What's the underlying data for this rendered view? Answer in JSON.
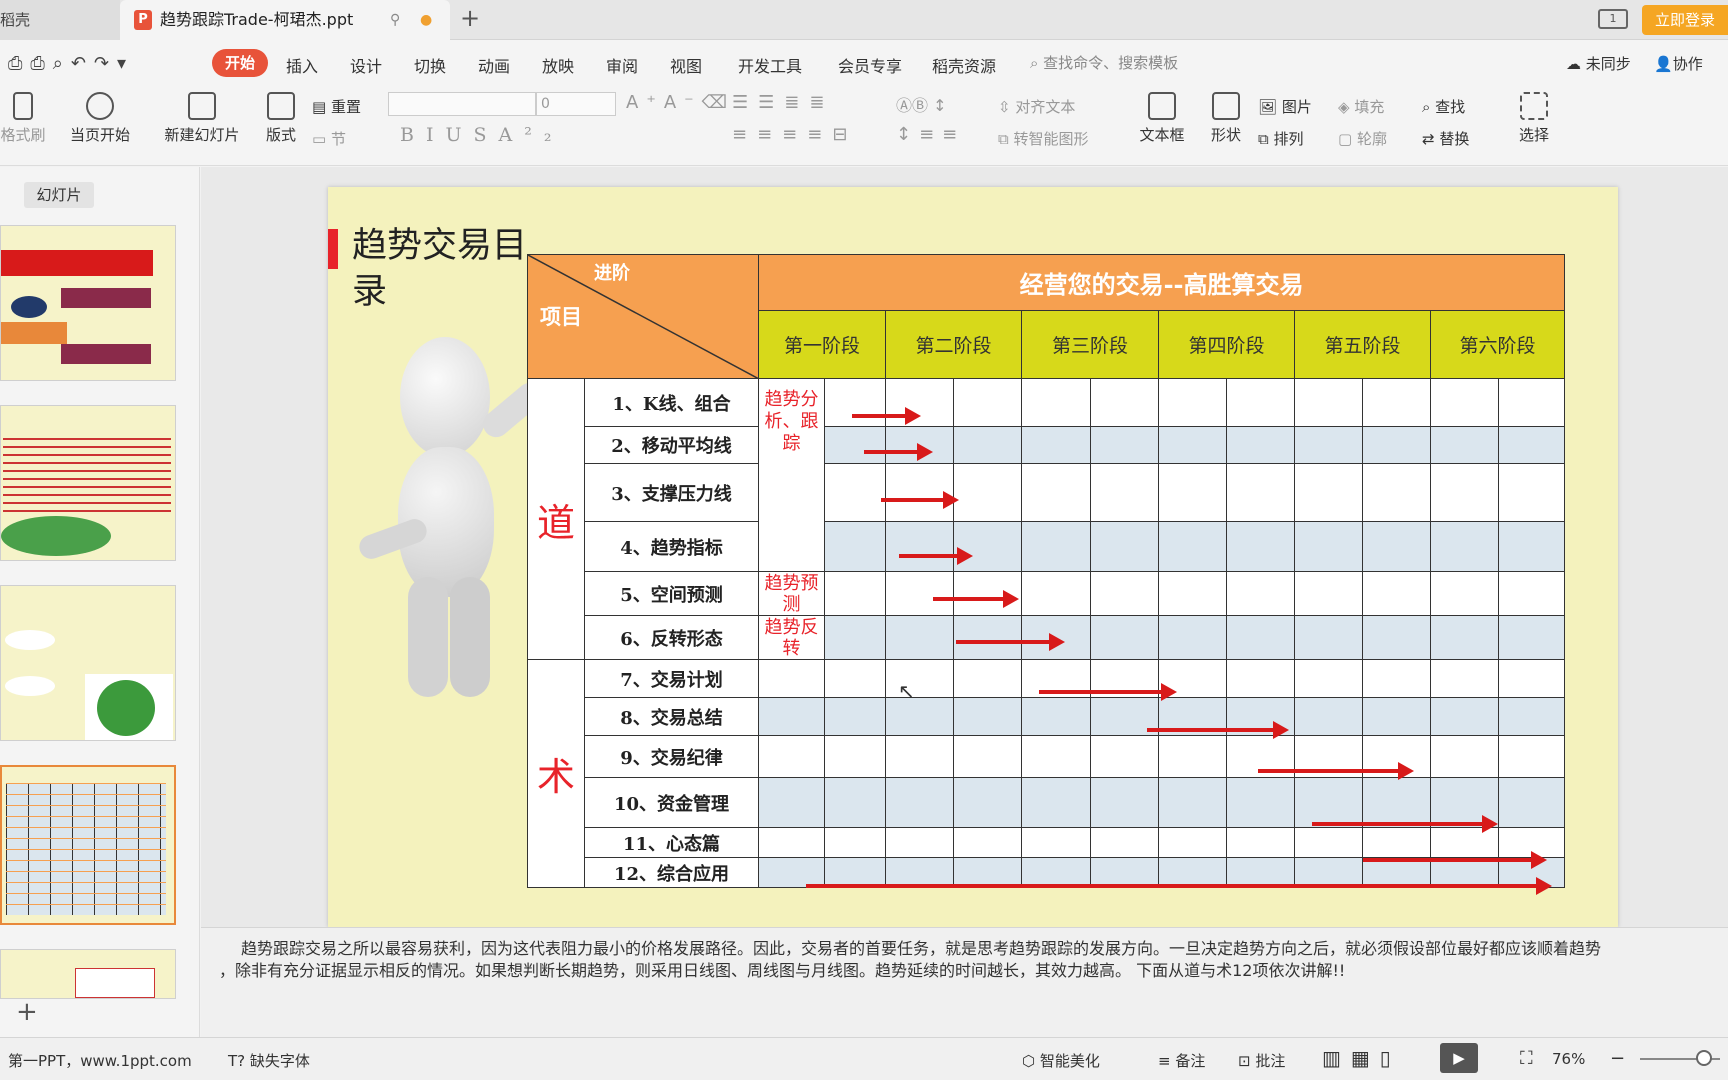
{
  "tabs": {
    "prev": "稻壳",
    "active": "趋势跟踪Trade-柯珺杰.ppt",
    "login": "立即登录"
  },
  "menu": {
    "items": [
      "开始",
      "插入",
      "设计",
      "切换",
      "动画",
      "放映",
      "审阅",
      "视图",
      "开发工具",
      "会员专享",
      "稻壳资源"
    ],
    "search": "查找命令、搜索模板",
    "sync": "未同步",
    "collab": "协作"
  },
  "ribbon": {
    "format_painter": "格式刷",
    "play_current": "当页开始",
    "new_slide": "新建幻灯片",
    "layout": "版式",
    "reset": "重置",
    "section": "节",
    "font_size": "0",
    "text_align": "对齐文本",
    "smart_shape": "转智能图形",
    "textbox": "文本框",
    "shape": "形状",
    "picture": "图片",
    "arrange": "排列",
    "fill": "填充",
    "outline": "轮廓",
    "find": "查找",
    "replace": "替换",
    "select": "选择"
  },
  "panel": {
    "tab": "幻灯片"
  },
  "slide": {
    "title": "趋势交易目录",
    "corner_top": "进阶",
    "corner_bottom": "项目",
    "header": "经营您的交易--高胜算交易",
    "stages": [
      "第一阶段",
      "第二阶段",
      "第三阶段",
      "第四阶段",
      "第五阶段",
      "第六阶段"
    ],
    "group_dao": "道",
    "group_shu": "术",
    "items": [
      "1、K线、组合",
      "2、移动平均线",
      "3、支撑压力线",
      "4、趋势指标",
      "5、空间预测",
      "6、反转形态",
      "7、交易计划",
      "8、交易总结",
      "9、交易纪律",
      "10、资金管理",
      "11、心态篇",
      "12、综合应用"
    ],
    "notes_a": "趋势分析、跟踪",
    "notes_b": "趋势预测",
    "notes_c": "趋势反转"
  },
  "notes": {
    "line1": "趋势跟踪交易之所以最容易获利，因为这代表阻力最小的价格发展路径。因此，交易者的首要任务，就是思考趋势跟踪的发展方向。一旦决定趋势方向之后，就必须假设部位最好都应该顺着趋势",
    "line2": "，除非有充分证据显示相反的情况。如果想判断长期趋势，则采用日线图、周线图与月线图。趋势延续的时间越长，其效力越高。 下面从道与术12项依次讲解!!"
  },
  "status": {
    "left": "第一PPT，www.1ppt.com",
    "font": "缺失字体",
    "beautify": "智能美化",
    "notes": "备注",
    "comment": "批注",
    "zoom": "76%"
  },
  "colors": {
    "accent": "#e8533a",
    "arrow": "#d81a1a",
    "header_orange": "#f6a050",
    "header_yellow": "#d7d91a"
  }
}
